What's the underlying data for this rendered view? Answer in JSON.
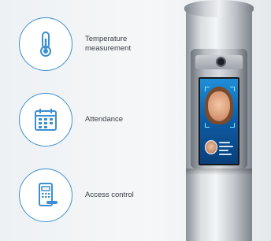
{
  "features": [
    {
      "label": "Temperature\nmeasurement",
      "icon": "thermometer-icon"
    },
    {
      "label": "Attendance",
      "icon": "calendar-icon"
    },
    {
      "label": "Access control",
      "icon": "door-lock-icon"
    }
  ],
  "colors": {
    "accent": "#3d8fd1"
  }
}
